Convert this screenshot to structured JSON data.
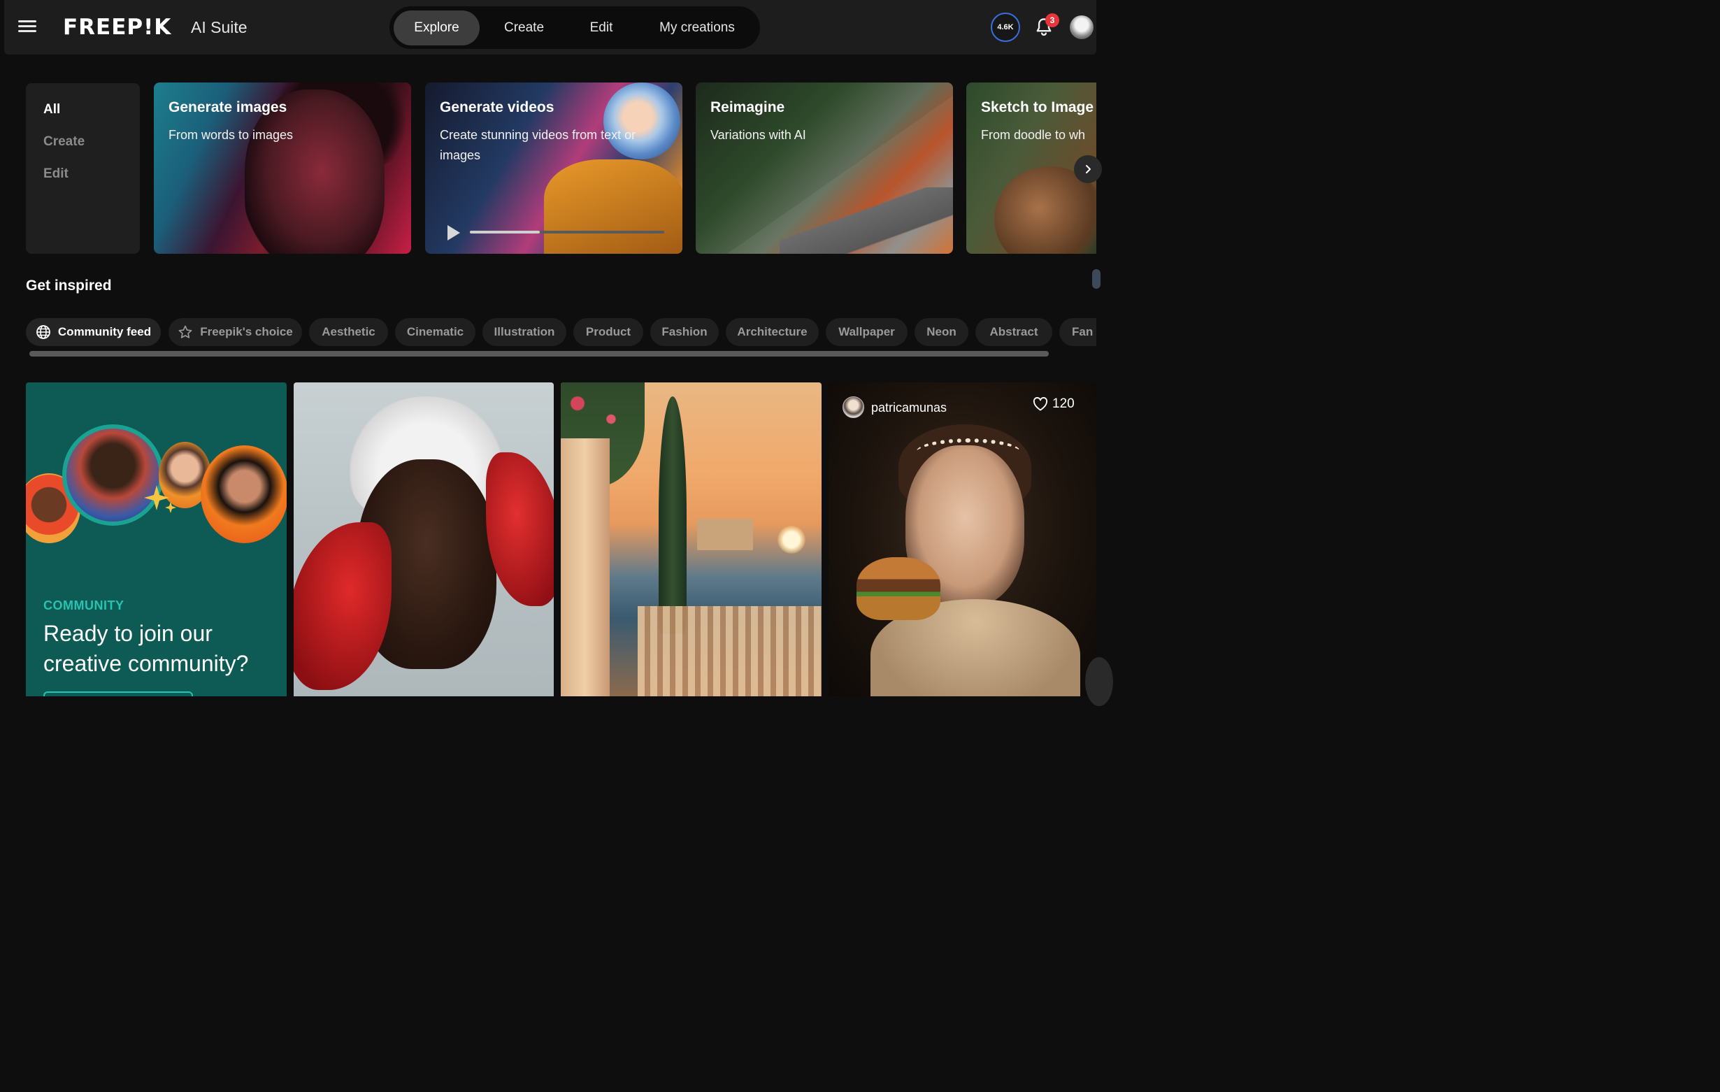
{
  "header": {
    "logo": "FREEP!K",
    "suite": "AI Suite",
    "nav": [
      {
        "label": "Explore",
        "active": true
      },
      {
        "label": "Create",
        "active": false
      },
      {
        "label": "Edit",
        "active": false
      },
      {
        "label": "My creations",
        "active": false
      }
    ],
    "credits": "4.6K",
    "notifications": "3",
    "icons": {
      "menu": "hamburger-icon",
      "bell": "bell-icon",
      "avatar": "user-avatar"
    }
  },
  "categories": [
    {
      "label": "All",
      "active": true
    },
    {
      "label": "Create",
      "active": false
    },
    {
      "label": "Edit",
      "active": false
    }
  ],
  "tools": [
    {
      "title": "Generate images",
      "subtitle": "From words to images"
    },
    {
      "title": "Generate videos",
      "subtitle": "Create stunning videos from text or images",
      "progress": 0.36
    },
    {
      "title": "Reimagine",
      "subtitle": "Variations with AI"
    },
    {
      "title": "Sketch to Image",
      "subtitle": "From doodle to wh"
    }
  ],
  "inspired": {
    "title": "Get inspired",
    "chips": [
      {
        "label": "Community feed",
        "icon": "globe-icon",
        "active": true
      },
      {
        "label": "Freepik's choice",
        "icon": "star-icon",
        "active": false
      },
      {
        "label": "Aesthetic",
        "active": false
      },
      {
        "label": "Cinematic",
        "active": false
      },
      {
        "label": "Illustration",
        "active": false
      },
      {
        "label": "Product",
        "active": false
      },
      {
        "label": "Fashion",
        "active": false
      },
      {
        "label": "Architecture",
        "active": false
      },
      {
        "label": "Wallpaper",
        "active": false
      },
      {
        "label": "Neon",
        "active": false
      },
      {
        "label": "Abstract",
        "active": false
      },
      {
        "label": "Fan",
        "active": false
      }
    ]
  },
  "community": {
    "label": "COMMUNITY",
    "heading": "Ready to join our creative community?"
  },
  "feed_item": {
    "username": "patricamunas",
    "likes": "120"
  },
  "colors": {
    "accent_teal": "#27c3b2",
    "community_bg": "#0d5b54",
    "badge_red": "#e6353b",
    "credits_ring": "#3a6fe0"
  }
}
